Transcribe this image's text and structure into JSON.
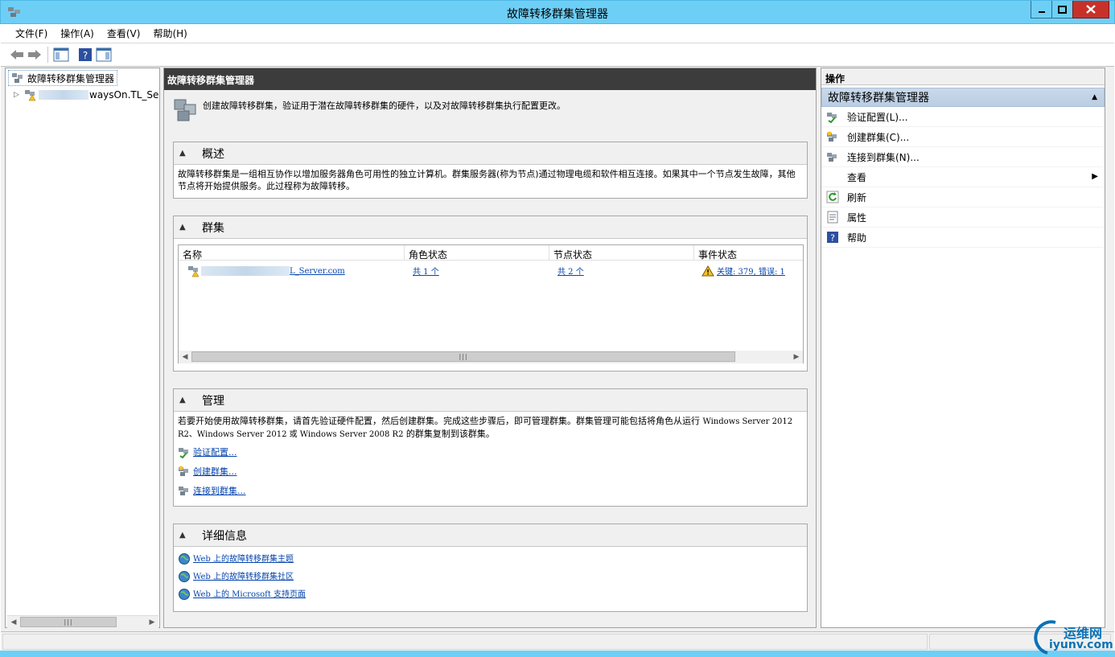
{
  "window": {
    "title": "故障转移群集管理器"
  },
  "menu": [
    "文件(F)",
    "操作(A)",
    "查看(V)",
    "帮助(H)"
  ],
  "tree": {
    "root": "故障转移群集管理器",
    "child_suffix": "waysOn.TL_Se"
  },
  "center": {
    "header": "故障转移群集管理器",
    "intro": "创建故障转移群集，验证用于潜在故障转移群集的硬件，以及对故障转移群集执行配置更改。",
    "overview": {
      "title": "概述",
      "text": "故障转移群集是一组相互协作以增加服务器角色可用性的独立计算机。群集服务器(称为节点)通过物理电缆和软件相互连接。如果其中一个节点发生故障，其他节点将开始提供服务。此过程称为故障转移。"
    },
    "clusters": {
      "title": "群集",
      "columns": [
        "名称",
        "角色状态",
        "节点状态",
        "事件状态"
      ],
      "rows": [
        {
          "name_suffix": "L_Server.com",
          "roles": "共 1 个",
          "nodes": "共 2 个",
          "events": "关键: 379, 错误: 1"
        }
      ]
    },
    "management": {
      "title": "管理",
      "text_a": "若要开始使用故障转移群集，请首先验证硬件配置，然后创建群集。完成这些步骤后，即可管理群集。群集管理可能包括将角色从运行 ",
      "text_b": "Windows Server 2012 R2、Windows Server 2012 或 Windows Server 2008 R2",
      "text_c": " 的群集复制到该群集。",
      "links": [
        "验证配置...",
        "创建群集...",
        "连接到群集..."
      ]
    },
    "details": {
      "title": "详细信息",
      "links": [
        "Web 上的故障转移群集主题",
        "Web 上的故障转移群集社区",
        "Web 上的 Microsoft 支持页面"
      ]
    }
  },
  "actions": {
    "title": "操作",
    "group": "故障转移群集管理器",
    "items": [
      "验证配置(L)...",
      "创建群集(C)...",
      "连接到群集(N)...",
      "查看",
      "刷新",
      "属性",
      "帮助"
    ]
  },
  "watermark": {
    "cn": "运维网",
    "en": "iyunv.com"
  }
}
